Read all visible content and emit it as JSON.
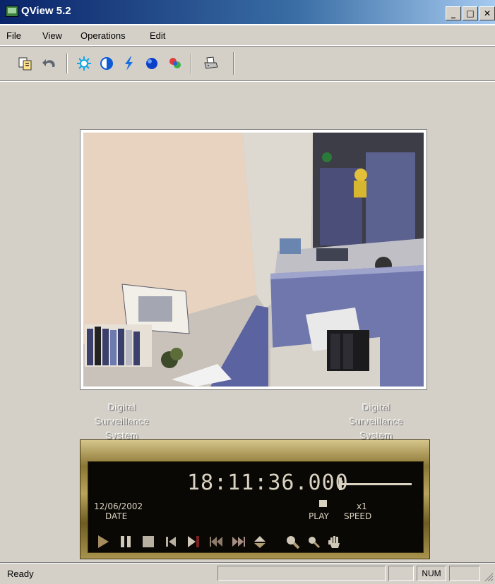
{
  "window": {
    "title": "QView 5.2",
    "minimize": "_",
    "maximize": "□",
    "close": "✕"
  },
  "menu": {
    "items": [
      {
        "label": "File"
      },
      {
        "label": "View"
      },
      {
        "label": "Operations"
      },
      {
        "label": "Edit"
      }
    ]
  },
  "toolbar": {
    "icons": [
      "copy-icon",
      "undo-icon",
      "brightness-icon",
      "contrast-icon",
      "sharpen-icon",
      "color-icon",
      "settings-icon",
      "print-icon"
    ]
  },
  "video": {
    "caption_left": [
      "Digital",
      "Surveillance",
      "System"
    ],
    "caption_right": [
      "Digital",
      "Surveillance",
      "System"
    ]
  },
  "player": {
    "time": "18:11:36.000",
    "date": "12/06/2002",
    "date_label": "DATE",
    "mode_label": "PLAY",
    "speed_value": "x1",
    "speed_label": "SPEED",
    "controls": [
      "play-icon",
      "pause-icon",
      "stop-icon",
      "previous-icon",
      "step-forward-icon",
      "rewind-icon",
      "fast-forward-icon",
      "eject-icon",
      "zoom-in-icon",
      "zoom-out-icon",
      "pan-hand-icon"
    ]
  },
  "status": {
    "text": "Ready",
    "num": "NUM"
  },
  "colors": {
    "titlebar": "#0a246a",
    "player_gold": "#b9a35c",
    "display_text": "#d9d2c0"
  }
}
